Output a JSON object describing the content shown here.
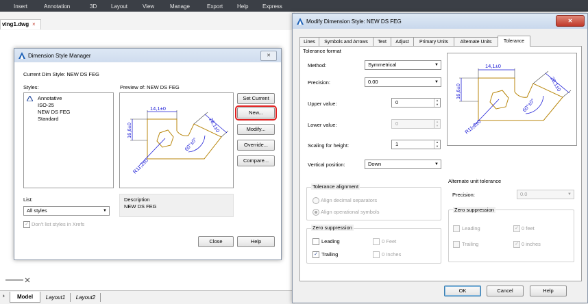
{
  "ribbon": {
    "items": [
      "Insert",
      "Annotation",
      "3D",
      "Layout",
      "View",
      "Manage",
      "Export",
      "Help",
      "Express"
    ]
  },
  "doc_tab": {
    "label": "ving1.dwg",
    "close": "×"
  },
  "layout_tabs": {
    "model": "Model",
    "layout1": "Layout1",
    "layout2": "Layout2"
  },
  "dsm": {
    "title": "Dimension Style Manager",
    "close": "✕",
    "current_style_label": "Current Dim Style: NEW DS FEG",
    "styles_label": "Styles:",
    "styles": [
      "Annotative",
      "ISO-25",
      "NEW DS FEG",
      "Standard"
    ],
    "preview_label": "Preview of: NEW DS FEG",
    "buttons": {
      "set_current": "Set Current",
      "new": "New...",
      "modify": "Modify...",
      "override": "Override...",
      "compare": "Compare...",
      "close": "Close",
      "help": "Help"
    },
    "list_label": "List:",
    "list_value": "All styles",
    "xrefs_label": "Don't list styles in Xrefs",
    "description_label": "Description",
    "description_value": "NEW DS FEG",
    "preview_dims": {
      "top": "14,1±0",
      "left": "16,6±0",
      "right": "28,1±0",
      "angle": "60°±0°",
      "radius": "R11,2±0"
    },
    "accent_highlight": "#e02020"
  },
  "mds": {
    "title": "Modify Dimension Style: NEW DS FEG",
    "close": "✕",
    "tabs": [
      "Lines",
      "Symbols and Arrows",
      "Text",
      "Adjust",
      "Primary Units",
      "Alternate Units",
      "Tolerance"
    ],
    "active_tab": "Tolerance",
    "tolerance_format_label": "Tolerance format",
    "method_label": "Method:",
    "method_value": "Symmetrical",
    "precision_label": "Precision:",
    "precision_value": "0.00",
    "upper_label": "Upper value:",
    "upper_value": "0",
    "lower_label": "Lower value:",
    "lower_value": "0",
    "scaling_label": "Scaling for height:",
    "scaling_value": "1",
    "vertical_label": "Vertical position:",
    "vertical_value": "Down",
    "alignment_label": "Tolerance alignment",
    "align_decimal": "Align decimal separators",
    "align_operational": "Align operational symbols",
    "zero_label": "Zero suppression",
    "leading": "Leading",
    "trailing": "Trailing",
    "zero_feet": "0 Feet",
    "zero_inches": "0 Inches",
    "alt_label": "Alternate unit tolerance",
    "alt_precision_label": "Precision:",
    "alt_precision_value": "0.0",
    "alt_zero_label": "Zero suppression",
    "alt_leading": "Leading",
    "alt_trailing": "Trailing",
    "alt_feet": "0 feet",
    "alt_inches": "0 inches",
    "buttons": {
      "ok": "OK",
      "cancel": "Cancel",
      "help": "Help"
    },
    "preview_dims": {
      "top": "14,1±0",
      "left": "16,6±0",
      "right": "28,1±0",
      "angle": "60°±0°",
      "radius": "R11,2±0"
    }
  }
}
